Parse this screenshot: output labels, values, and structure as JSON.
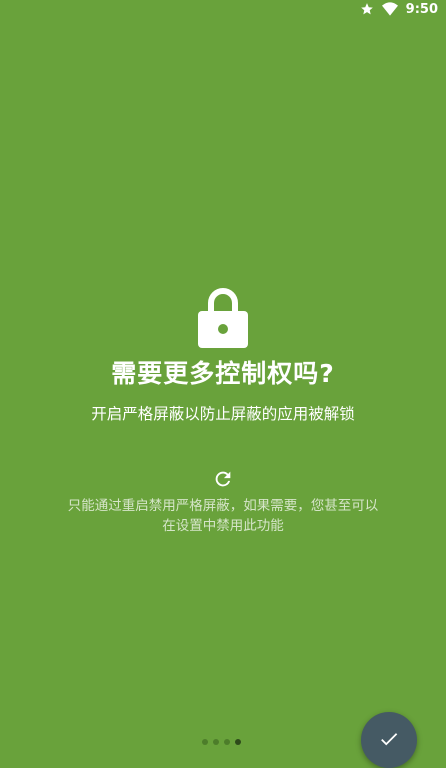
{
  "status_bar": {
    "time": "9:50"
  },
  "main": {
    "title": "需要更多控制权吗?",
    "subtitle": "开启严格屏蔽以防止屏蔽的应用被解锁",
    "note": "只能通过重启禁用严格屏蔽，如果需要，您甚至可以在设置中禁用此功能"
  },
  "pager": {
    "dot_count": 4,
    "active_index": 3
  },
  "icons": {
    "status": [
      "star-icon",
      "wifi-icon"
    ],
    "hero": "lock-icon",
    "note": "refresh-icon",
    "fab": "check-icon"
  },
  "colors": {
    "background": "#69A23B",
    "fab": "#455A64"
  }
}
